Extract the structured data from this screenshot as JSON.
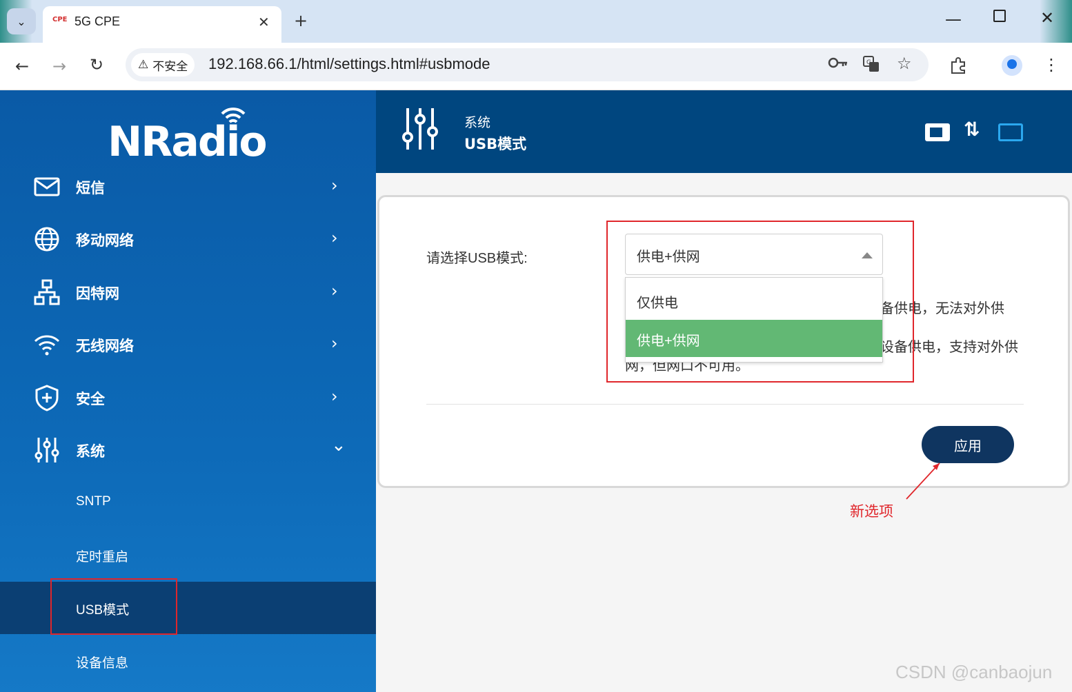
{
  "browser": {
    "tab": {
      "favicon_text": "CPE",
      "title": "5G CPE",
      "close": "✕"
    },
    "new_tab": "+",
    "window": {
      "minimize": "—",
      "close": "✕"
    },
    "nav": {
      "back": "←",
      "forward": "→",
      "reload": "↻"
    },
    "security_label": "不安全",
    "url": "192.168.66.1/html/settings.html#usbmode",
    "icons": [
      "key-icon",
      "translate-icon",
      "star-icon",
      "extensions-icon",
      "profile-icon",
      "more-icon"
    ]
  },
  "sidebar": {
    "logo": "NRadio",
    "items": [
      {
        "label": "短信",
        "icon": "mail-icon",
        "chevron": "›"
      },
      {
        "label": "移动网络",
        "icon": "globe-icon",
        "chevron": "›"
      },
      {
        "label": "因特网",
        "icon": "network-icon",
        "chevron": "›"
      },
      {
        "label": "无线网络",
        "icon": "wifi-icon",
        "chevron": "›"
      },
      {
        "label": "安全",
        "icon": "shield-icon",
        "chevron": "›"
      },
      {
        "label": "系统",
        "icon": "sliders-icon",
        "chevron": "⌄",
        "expanded": true
      }
    ],
    "sub_items": [
      {
        "label": "SNTP"
      },
      {
        "label": "定时重启"
      },
      {
        "label": "USB模式",
        "active": true
      },
      {
        "label": "设备信息"
      }
    ]
  },
  "header": {
    "category": "系统",
    "title": "USB模式",
    "status_icons": [
      "sim-icon",
      "data-transfer-icon",
      "network-status-icon"
    ]
  },
  "form": {
    "label": "请选择USB模式:",
    "selected_value": "供电+供网",
    "options": [
      "仅供电",
      "供电+供网"
    ],
    "desc_line1_visible": "备供电，无法对外供",
    "desc_line2_visible": "设备供电，支持对外供",
    "desc_line3_visible": "网，但网口不可用。",
    "apply": "应用"
  },
  "annotation": {
    "text": "新选项",
    "color": "#e0262b"
  },
  "watermark": "CSDN @canbaojun",
  "colors": {
    "sidebar": "#0a5aa6",
    "header": "#00467f",
    "active_sub": "#0b3f73",
    "option_selected": "#62b874",
    "apply_button": "#0f3560",
    "annotation": "#e0262b"
  }
}
